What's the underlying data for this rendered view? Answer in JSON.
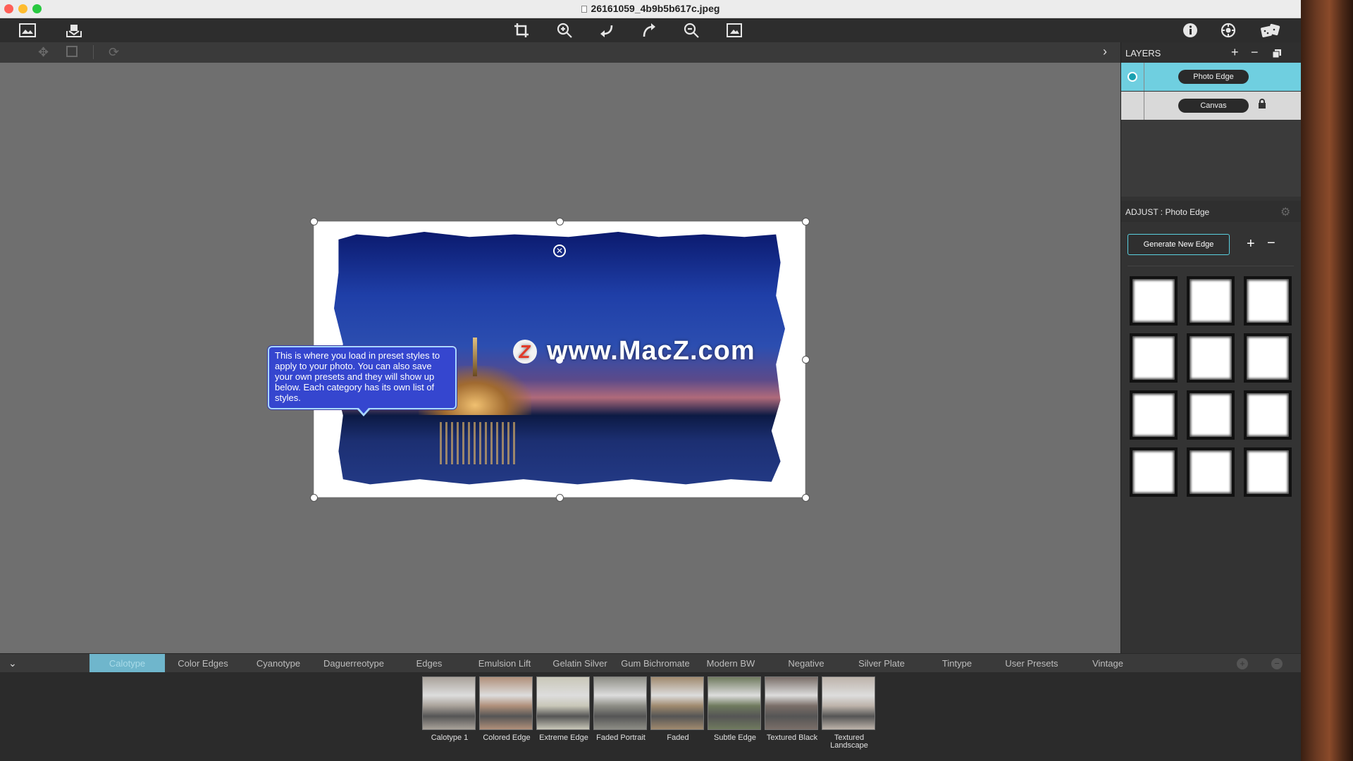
{
  "window": {
    "title": "26161059_4b9b5b617c.jpeg",
    "traffic_colors": [
      "#fe5f57",
      "#febc2e",
      "#28c840"
    ]
  },
  "toolbar": {
    "left_icons": [
      "image-icon",
      "import-icon"
    ],
    "center_icons": [
      "crop-icon",
      "zoom-in-icon",
      "undo-icon",
      "redo-icon",
      "zoom-out-icon",
      "fit-to-screen-icon"
    ],
    "right_icons": [
      "info-icon",
      "settings-icon",
      "dice-icon"
    ]
  },
  "canvas": {
    "watermark": "www.MacZ.com",
    "watermark_logo": "Z",
    "tooltip": "This is where you load in preset styles to apply to your photo. You can also save your own presets and they will show up below. Each category has its own list of styles."
  },
  "layers": {
    "title": "LAYERS",
    "items": [
      {
        "label": "Photo Edge",
        "selected": true
      },
      {
        "label": "Canvas",
        "locked": true
      }
    ]
  },
  "adjust": {
    "title": "ADJUST : Photo Edge",
    "generate_label": "Generate New Edge",
    "edge_count": 12
  },
  "categories": {
    "tabs": [
      "Calotype",
      "Color Edges",
      "Cyanotype",
      "Daguerreotype",
      "Edges",
      "Emulsion Lift",
      "Gelatin Silver",
      "Gum Bichromate",
      "Modern BW",
      "Negative",
      "Silver Plate",
      "Tintype",
      "User Presets",
      "Vintage"
    ],
    "active": "Calotype"
  },
  "presets": [
    {
      "label": "Calotype 1",
      "tint": "#a9a29a"
    },
    {
      "label": "Colored Edge",
      "tint": "#b0907a"
    },
    {
      "label": "Extreme Edge",
      "tint": "#c9c7b8"
    },
    {
      "label": "Faded Portrait",
      "tint": "#8e8e86"
    },
    {
      "label": "Faded",
      "tint": "#a08a6e"
    },
    {
      "label": "Subtle Edge",
      "tint": "#6f7a5e"
    },
    {
      "label": "Textured Black",
      "tint": "#7a6e68"
    },
    {
      "label": "Textured Landscape",
      "tint": "#bdb3aa"
    }
  ],
  "colors": {
    "accent": "#6fcfe0",
    "tooltip_bg": "#3546cf"
  }
}
